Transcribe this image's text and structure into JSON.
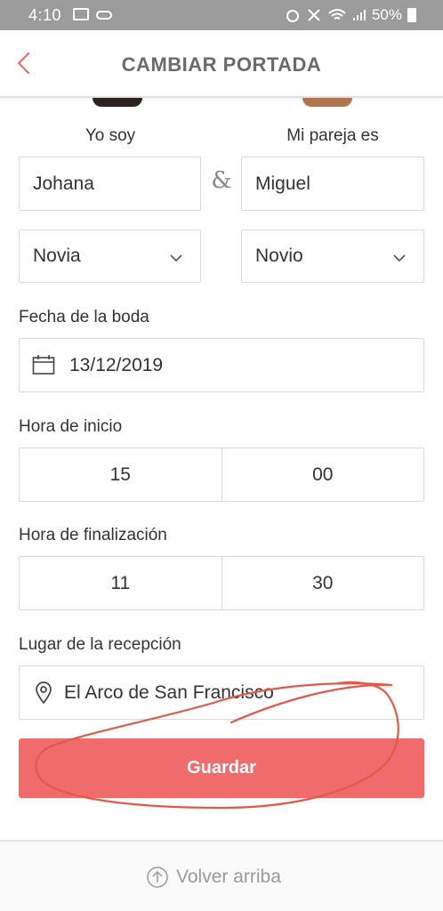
{
  "status_bar": {
    "time": "4:10",
    "battery": "50%"
  },
  "header": {
    "title": "CAMBIAR PORTADA"
  },
  "couple": {
    "me_label": "Yo soy",
    "partner_label": "Mi pareja es",
    "me_name": "Johana",
    "partner_name": "Miguel",
    "ampersand": "&",
    "me_role": "Novia",
    "partner_role": "Novio"
  },
  "wedding_date": {
    "label": "Fecha de la boda",
    "value": "13/12/2019"
  },
  "start_time": {
    "label": "Hora de inicio",
    "hour": "15",
    "minute": "00"
  },
  "end_time": {
    "label": "Hora de finalización",
    "hour": "11",
    "minute": "30"
  },
  "reception": {
    "label": "Lugar de la recepción",
    "value": "El Arco de San Francisco"
  },
  "save_button": {
    "label": "Guardar"
  },
  "footer": {
    "back_to_top": "Volver arriba"
  },
  "colors": {
    "accent": "#f06b6b",
    "status_bar": "#9b9b9b",
    "scribble": "#e05a4a"
  }
}
